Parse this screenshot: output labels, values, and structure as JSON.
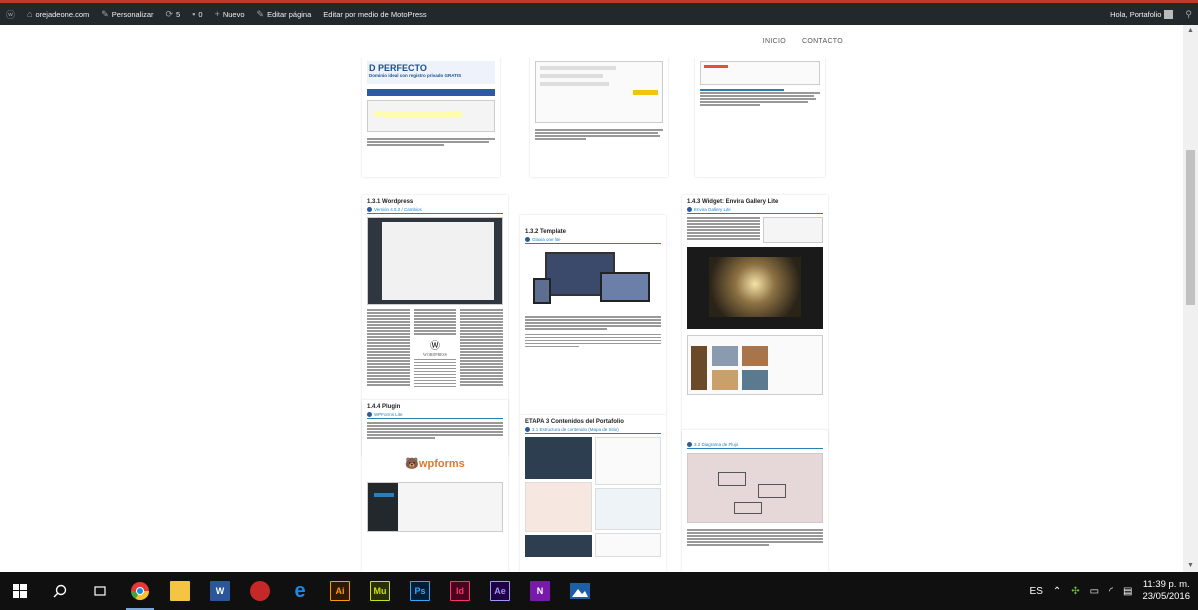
{
  "adminbar": {
    "site": "orejadeone.com",
    "customize": "Personalizar",
    "updates": "5",
    "comments": "0",
    "new": "Nuevo",
    "edit_page": "Editar página",
    "motopress": "Editar por medio de MotoPress",
    "greeting": "Hola, Portafolio"
  },
  "nav": {
    "home": "INICIO",
    "contact": "CONTACTO"
  },
  "pages": {
    "p1": {
      "title": "D PERFECTO",
      "subtitle": "Dominio ideal con registro privado GRATIS"
    },
    "p4": {
      "title": "1.3.1 Wordpress",
      "sub": "Versión 4.5.2 / Cambios",
      "logo": "WORDPRESS"
    },
    "p5": {
      "title": "1.3.2 Template",
      "sub": "Glaxia one lite"
    },
    "p6": {
      "title": "1.4.3 Widget: Envira Gallery Lite",
      "sub": "Envira Gallery Lite"
    },
    "p7": {
      "title": "1.4.4 Plugin",
      "sub": "WPForms Lite",
      "logo": "wpforms"
    },
    "p8": {
      "title": "ETAPA 3 Contenidos del Portafolio",
      "sub": "3.1 Estructura de contenido (Mapa de Sitio)"
    },
    "p9": {
      "sub": "3.2 Diagrama de Flujo"
    }
  },
  "taskbar": {
    "apps": [
      {
        "name": "chrome",
        "label": ""
      },
      {
        "name": "file-explorer",
        "label": ""
      },
      {
        "name": "word",
        "label": "W"
      },
      {
        "name": "app-red",
        "label": ""
      },
      {
        "name": "edge",
        "label": "e"
      },
      {
        "name": "illustrator",
        "label": "Ai"
      },
      {
        "name": "muse",
        "label": "Mu"
      },
      {
        "name": "photoshop",
        "label": "Ps"
      },
      {
        "name": "indesign",
        "label": "Id"
      },
      {
        "name": "after-effects",
        "label": "Ae"
      },
      {
        "name": "onenote",
        "label": "N"
      },
      {
        "name": "photos",
        "label": ""
      }
    ],
    "lang": "ES",
    "time": "11:39 p. m.",
    "date": "23/05/2016"
  },
  "colors": {
    "adminbar": "#23282d",
    "accent": "#c0392b",
    "link": "#2980b9",
    "taskbar": "#101010"
  }
}
